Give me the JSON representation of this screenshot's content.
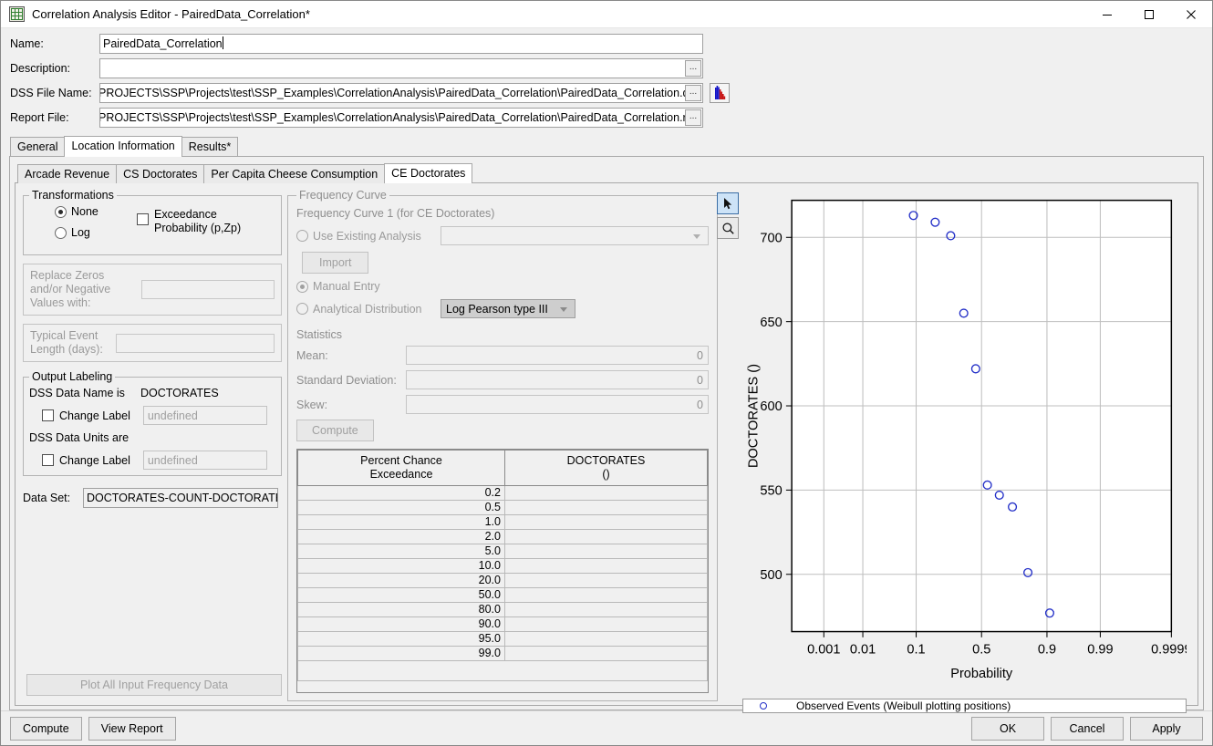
{
  "window": {
    "title": "Correlation Analysis Editor - PairedData_Correlation*",
    "app_icon": "grid-chart-icon",
    "minimize": "minimize-icon",
    "maximize": "maximize-icon",
    "close": "close-icon"
  },
  "form": {
    "name_label": "Name:",
    "name_value": "PairedData_Correlation",
    "description_label": "Description:",
    "description_value": "",
    "dss_label": "DSS File Name:",
    "dss_value": "PROJECTS\\SSP\\Projects\\test\\SSP_Examples\\CorrelationAnalysis\\PairedData_Correlation\\PairedData_Correlation.dss",
    "report_label": "Report File:",
    "report_value": "PROJECTS\\SSP\\Projects\\test\\SSP_Examples\\CorrelationAnalysis\\PairedData_Correlation\\PairedData_Correlation.rpt",
    "browse_glyph": "...",
    "dss_icon": "histogram-icon"
  },
  "tabs_outer": [
    {
      "label": "General",
      "active": false
    },
    {
      "label": "Location Information",
      "active": true
    },
    {
      "label": "Results*",
      "active": false
    }
  ],
  "tabs_inner": [
    {
      "label": "Arcade Revenue",
      "active": false
    },
    {
      "label": "CS Doctorates",
      "active": false
    },
    {
      "label": "Per Capita Cheese Consumption",
      "active": false
    },
    {
      "label": "CE Doctorates",
      "active": true
    }
  ],
  "transformations": {
    "legend": "Transformations",
    "none_label": "None",
    "none_checked": true,
    "log_label": "Log",
    "log_checked": false,
    "exceedance_label": "Exceedance Probability (p,Zp)",
    "exceedance_checked": false
  },
  "replace_zeros": {
    "label": "Replace Zeros and/or Negative Values with:",
    "value": ""
  },
  "typical_event": {
    "label": "Typical Event Length (days):",
    "value": ""
  },
  "output_labeling": {
    "legend": "Output Labeling",
    "name_is_label": "DSS Data Name is",
    "name_is_value": "DOCTORATES",
    "change_label_1": "Change Label",
    "change_label_1_checked": false,
    "placeholder_1": "undefined",
    "units_are_label": "DSS Data Units are",
    "units_are_value": "",
    "change_label_2": "Change Label",
    "change_label_2_checked": false,
    "placeholder_2": "undefined"
  },
  "dataset": {
    "label": "Data Set:",
    "value": "DOCTORATES-COUNT-DOCTORATES"
  },
  "plot_all_button": "Plot All Input Frequency Data",
  "frequency_curve": {
    "legend": "Frequency Curve",
    "subtitle": "Frequency Curve 1 (for CE Doctorates)",
    "use_existing_label": "Use Existing Analysis",
    "use_existing_checked": false,
    "existing_value": "",
    "import_button": "Import",
    "manual_entry_label": "Manual Entry",
    "manual_entry_checked": true,
    "analytical_label": "Analytical Distribution",
    "analytical_checked": false,
    "distribution_value": "Log Pearson type III",
    "statistics_header": "Statistics",
    "mean_label": "Mean:",
    "mean_value": "0",
    "stddev_label": "Standard Deviation:",
    "stddev_value": "0",
    "skew_label": "Skew:",
    "skew_value": "0",
    "compute_button": "Compute"
  },
  "table": {
    "col1_header_line1": "Percent Chance",
    "col1_header_line2": "Exceedance",
    "col2_header_line1": "DOCTORATES",
    "col2_header_line2": "()",
    "rows": [
      {
        "pct": "0.2",
        "value": ""
      },
      {
        "pct": "0.5",
        "value": ""
      },
      {
        "pct": "1.0",
        "value": ""
      },
      {
        "pct": "2.0",
        "value": ""
      },
      {
        "pct": "5.0",
        "value": ""
      },
      {
        "pct": "10.0",
        "value": ""
      },
      {
        "pct": "20.0",
        "value": ""
      },
      {
        "pct": "50.0",
        "value": ""
      },
      {
        "pct": "80.0",
        "value": ""
      },
      {
        "pct": "90.0",
        "value": ""
      },
      {
        "pct": "95.0",
        "value": ""
      },
      {
        "pct": "99.0",
        "value": ""
      }
    ]
  },
  "chart_tools": [
    {
      "name": "arrow-select-tool",
      "active": true
    },
    {
      "name": "zoom-tool",
      "active": false
    }
  ],
  "chart_data": {
    "type": "scatter",
    "title": "",
    "xlabel": "Probability",
    "ylabel": "DOCTORATES ()",
    "grid": true,
    "x_tick_labels": [
      "0.9999",
      "0.99",
      "0.9",
      "0.5",
      "0.1",
      "0.01",
      "0.001"
    ],
    "x_tick_positions": [
      0.9999,
      0.99,
      0.9,
      0.5,
      0.1,
      0.01,
      0.001
    ],
    "y_tick_labels": [
      "500",
      "550",
      "600",
      "650",
      "700"
    ],
    "y_tick_values": [
      500,
      550,
      600,
      650,
      700
    ],
    "ylim": [
      466,
      722
    ],
    "xlim_norm": [
      -3.719,
      3.719
    ],
    "series": [
      {
        "name": "Observed Events (Weibull plotting positions)",
        "marker": "open-circle",
        "color": "#2430c8",
        "points": [
          {
            "probability": 0.9091,
            "value": 477
          },
          {
            "probability": 0.8182,
            "value": 501
          },
          {
            "probability": 0.7273,
            "value": 540
          },
          {
            "probability": 0.6364,
            "value": 547
          },
          {
            "probability": 0.5455,
            "value": 553
          },
          {
            "probability": 0.4545,
            "value": 622
          },
          {
            "probability": 0.3636,
            "value": 655
          },
          {
            "probability": 0.2727,
            "value": 701
          },
          {
            "probability": 0.1818,
            "value": 709
          },
          {
            "probability": 0.0909,
            "value": 713
          }
        ]
      }
    ],
    "legend_position": "bottom",
    "legend_entries": [
      "Observed Events (Weibull plotting positions)"
    ]
  },
  "bottom_bar": {
    "compute": "Compute",
    "view_report": "View Report",
    "ok": "OK",
    "cancel": "Cancel",
    "apply": "Apply"
  }
}
